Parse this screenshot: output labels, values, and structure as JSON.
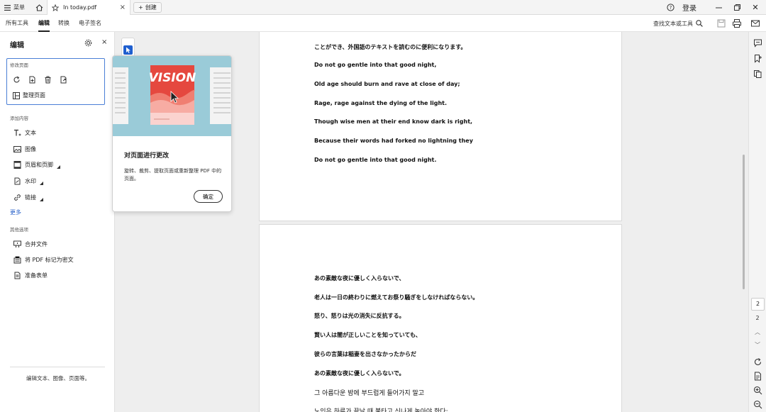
{
  "titlebar": {
    "menu_label": "菜单",
    "tab_title": "In today.pdf",
    "tab_close": "×",
    "new_tab_label": "创建",
    "login_label": "登录",
    "close_symbol": "✕"
  },
  "menubar": {
    "tabs": [
      {
        "label": "所有工具"
      },
      {
        "label": "编辑"
      },
      {
        "label": "转换"
      },
      {
        "label": "电子签名"
      }
    ],
    "find_tool": "查找文本或工具"
  },
  "leftpanel": {
    "title": "编辑",
    "close_symbol": "×",
    "modify_section": "修改页面",
    "organize_label": "整理页面",
    "add_section": "添加内容",
    "add_items": [
      {
        "label": "文本",
        "icon": "text-add-icon"
      },
      {
        "label": "图像",
        "icon": "image-icon"
      },
      {
        "label": "页眉和页脚",
        "icon": "header-footer-icon"
      },
      {
        "label": "水印",
        "icon": "watermark-icon"
      },
      {
        "label": "链接",
        "icon": "link-icon"
      }
    ],
    "more_label": "更多",
    "other_section": "其他选项",
    "other_items": [
      {
        "label": "合并文件",
        "icon": "combine-icon"
      },
      {
        "label": "将 PDF 标记为密文",
        "icon": "redact-icon"
      },
      {
        "label": "准备表单",
        "icon": "form-icon"
      }
    ],
    "footer_text": "编辑文本、图像、页面等。"
  },
  "popup": {
    "illustration_text": "VISION",
    "title": "对页面进行更改",
    "description": "旋转、裁剪、提取页面或重新整理 PDF 中的页面。",
    "ok_label": "确定"
  },
  "page1_lines": [
    "ことができ、外国語のテキストを読むのに便利になります。",
    "Do not go gentle into that good night,",
    "Old age should burn and rave at close of day;",
    "Rage, rage against the dying of the light.",
    "Though wise men at their end know dark is right,",
    "Because their words had forked no lightning they",
    "Do not go gentle into that good night."
  ],
  "page2_lines": [
    "あの素敵な夜に優しく入らないで、",
    "老人は一日の終わりに燃えてお祭り騒ぎをしなければならない。",
    "怒り、怒りは光の消失に反抗する。",
    "賢い人は闇が正しいことを知っていても、",
    "彼らの言葉は稲妻を出さなかったからだ",
    "あの素敵な夜に優しく入らないで。",
    "그 아름다운 밤에 부드럽게 들어가지 말고",
    "노인은 하루가 끝날 때 불타고 신나게 놀아야 한다;"
  ],
  "pagination": {
    "current": "2",
    "total": "2"
  },
  "colors": {
    "accent": "#1f5fcf",
    "illustration_bg": "#9acbd8",
    "vision_red": "#e5483f"
  }
}
